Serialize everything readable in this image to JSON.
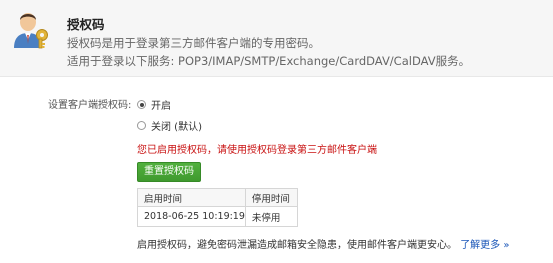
{
  "header": {
    "title": "授权码",
    "desc_line1": "授权码是用于登录第三方邮件客户端的专用密码。",
    "desc_line2": "适用于登录以下服务: POP3/IMAP/SMTP/Exchange/CardDAV/CalDAV服务。",
    "icon": "user-key-icon"
  },
  "setting": {
    "label": "设置客户端授权码:",
    "options": [
      {
        "label": "开启",
        "checked": true
      },
      {
        "label": "关闭 (默认)",
        "checked": false
      }
    ]
  },
  "warning": "您已启用授权码，请使用授权码登录第三方邮件客户端",
  "reset_button": "重置授权码",
  "table": {
    "headers": [
      "启用时间",
      "停用时间"
    ],
    "rows": [
      [
        "2018-06-25 10:19:19",
        "未停用"
      ]
    ]
  },
  "footer": {
    "text": "启用授权码，避免密码泄漏造成邮箱安全隐患，使用邮件客户端更安心。",
    "link": "了解更多",
    "link_suffix": "»"
  },
  "colors": {
    "accent_green": "#48a636",
    "warning_red": "#c81010",
    "link_blue": "#1a56b8"
  }
}
